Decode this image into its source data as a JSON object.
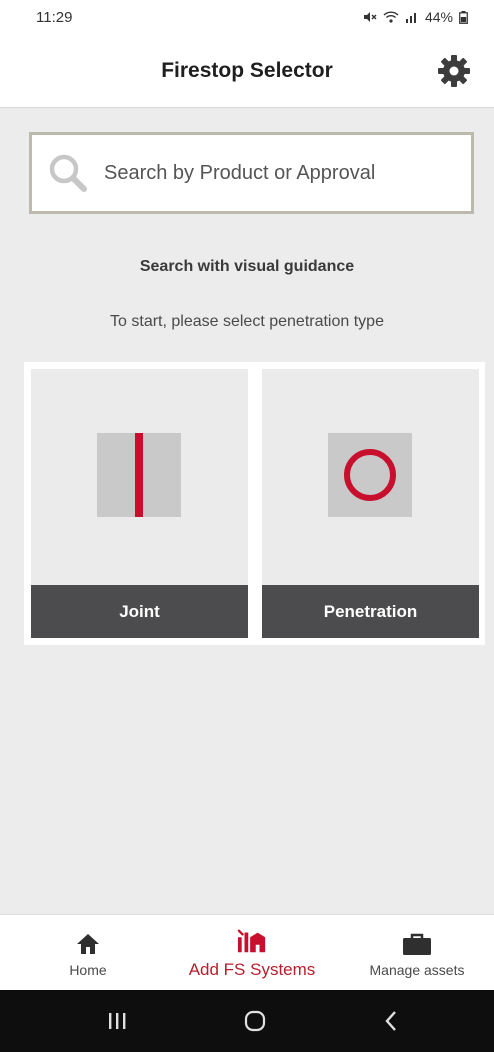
{
  "status_bar": {
    "time": "11:29",
    "battery": "44%"
  },
  "header": {
    "title": "Firestop Selector",
    "settings_icon": "gear-icon"
  },
  "search": {
    "placeholder": "Search by Product or Approval",
    "value": ""
  },
  "guidance": {
    "title": "Search with visual guidance",
    "subtitle": "To start, please select penetration type"
  },
  "cards": [
    {
      "label": "Joint",
      "icon": "joint-line-icon"
    },
    {
      "label": "Penetration",
      "icon": "penetration-circle-icon"
    }
  ],
  "bottom_nav": {
    "items": [
      {
        "label": "Home",
        "icon": "home-icon",
        "active": false
      },
      {
        "label": "Add FS Systems",
        "icon": "add-fs-systems-icon",
        "active": true
      },
      {
        "label": "Manage assets",
        "icon": "briefcase-icon",
        "active": false
      }
    ]
  },
  "colors": {
    "accent": "#c8102e",
    "card_footer": "#4c4b4d",
    "background": "#ececec",
    "active_nav": "#b51f2e"
  }
}
